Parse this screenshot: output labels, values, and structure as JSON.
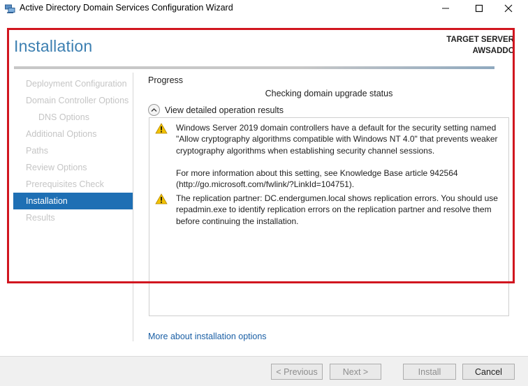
{
  "window": {
    "title": "Active Directory Domain Services Configuration Wizard",
    "minimize_glyph": "—",
    "maximize_glyph": "☐",
    "close_glyph": "✕"
  },
  "header": {
    "heading": "Installation",
    "target_server_label": "TARGET SERVER",
    "target_server_name": "AWSADDC"
  },
  "nav": {
    "items": [
      {
        "label": "Deployment Configuration"
      },
      {
        "label": "Domain Controller Options"
      },
      {
        "label": "DNS Options"
      },
      {
        "label": "Additional Options"
      },
      {
        "label": "Paths"
      },
      {
        "label": "Review Options"
      },
      {
        "label": "Prerequisites Check"
      },
      {
        "label": "Installation"
      },
      {
        "label": "Results"
      }
    ],
    "active": "Installation"
  },
  "progress": {
    "label": "Progress",
    "status": "Checking domain upgrade status",
    "view_details": "View detailed operation results"
  },
  "messages": [
    {
      "icon": "warning-icon",
      "para1": "Windows Server 2019 domain controllers have a default for the security setting named \"Allow cryptography algorithms compatible with Windows NT 4.0\" that prevents weaker cryptography algorithms when establishing security channel sessions.",
      "para2": "For more information about this setting, see Knowledge Base article 942564 (http://go.microsoft.com/fwlink/?LinkId=104751)."
    },
    {
      "icon": "warning-icon",
      "para1": "The replication partner: DC.endergumen.local shows replication errors. You should use repadmin.exe to identify replication errors on the replication partner and resolve them before continuing the installation."
    }
  ],
  "more_link": "More about installation options",
  "footer": {
    "previous": "< Previous",
    "next": "Next >",
    "install": "Install",
    "cancel": "Cancel"
  },
  "colors": {
    "heading": "#3c7fb1",
    "nav_active_bg": "#1e6fb4",
    "link": "#1a5fa5",
    "highlight_border": "#d1161f",
    "warning": "#f2c200"
  }
}
